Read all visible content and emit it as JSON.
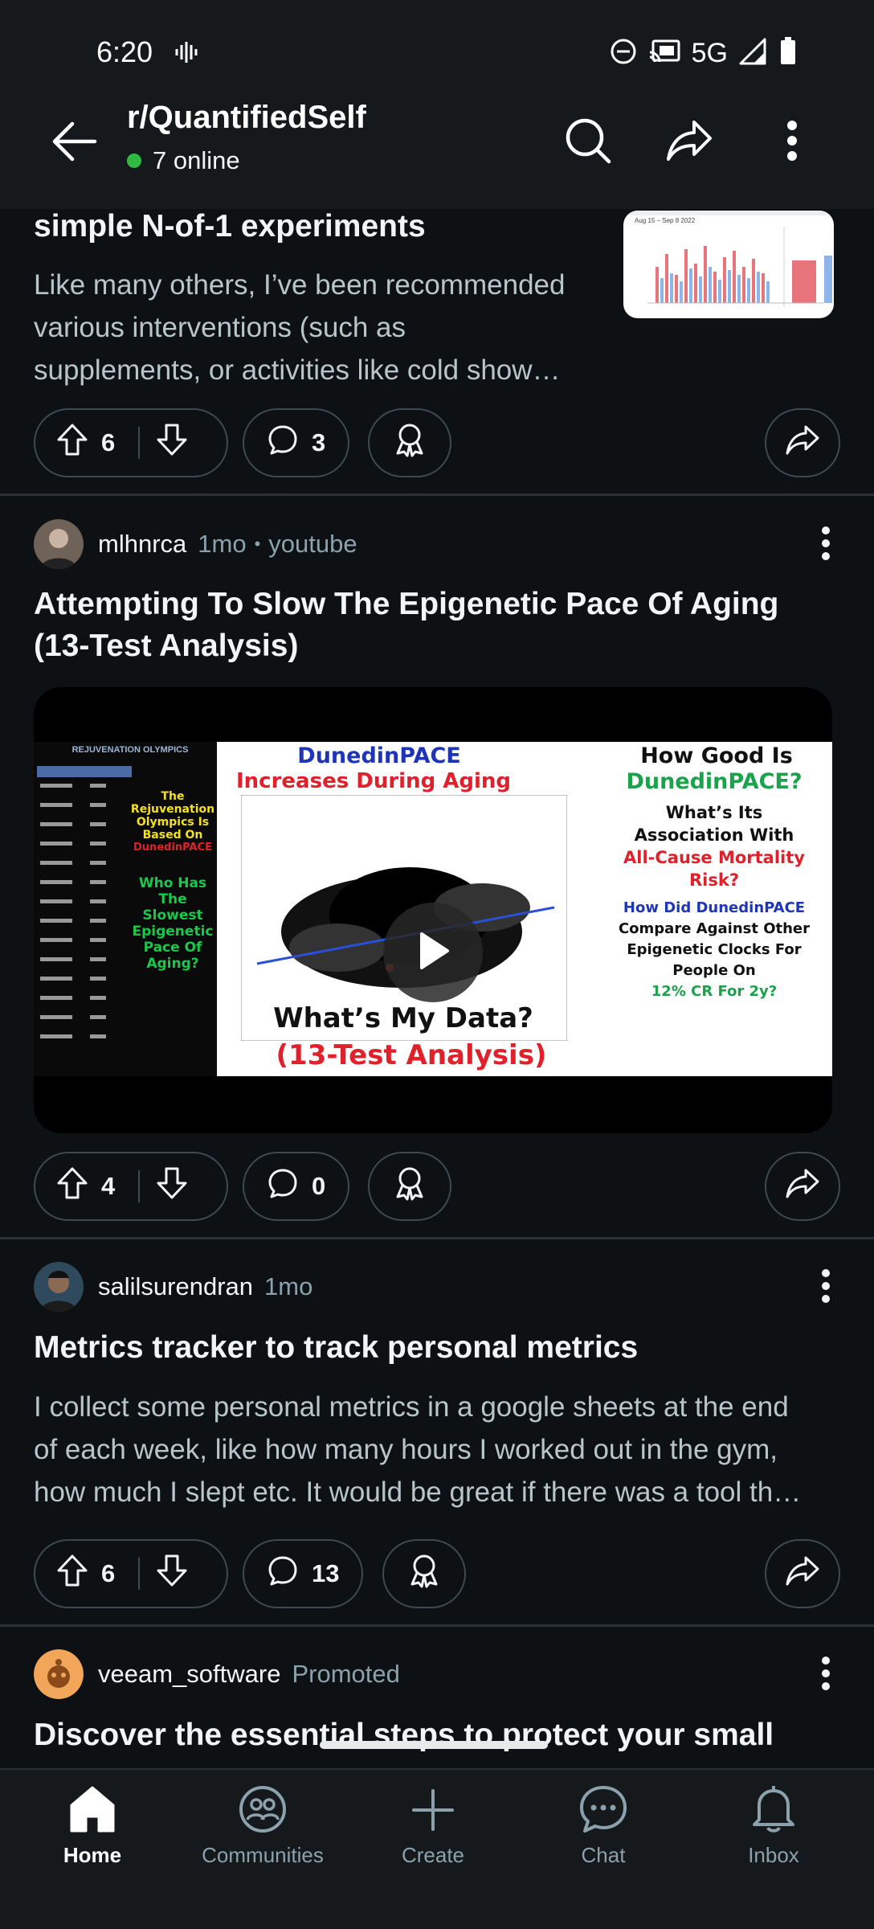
{
  "status": {
    "time": "6:20",
    "network": "5G"
  },
  "header": {
    "subreddit": "r/QuantifiedSelf",
    "online": "7 online"
  },
  "posts": [
    {
      "title": "simple N-of-1 experiments",
      "body_lines": [
        "Like many others, I’ve been recommended",
        "various interventions (such as",
        "supplements, or activities like cold show…"
      ],
      "upvotes": "6",
      "comments": "3",
      "thumbnail_caption": "Aug 15 – Sep 8 2022"
    },
    {
      "author": "mlhnrca",
      "age": "1mo",
      "source": "youtube",
      "title_lines": [
        "Attempting To Slow The Epigenetic Pace Of Aging",
        "(13-Test Analysis)"
      ],
      "upvotes": "4",
      "comments": "0",
      "video": {
        "title_1": "DunedinPACE",
        "title_2": "Increases During Aging",
        "right_1": "How Good Is",
        "right_2": "DunedinPACE?",
        "right_3": "What’s Its",
        "right_4": "Association With",
        "right_5": "All-Cause Mortality",
        "right_6": "Risk?",
        "right_7": "How Did DunedinPACE",
        "right_8": "Compare Against Other",
        "right_9": "Epigenetic Clocks For",
        "right_10": "People On",
        "right_11": "12% CR For 2y?",
        "bottom_1": "What’s My Data?",
        "bottom_2": "(13-Test Analysis)",
        "left_logo": "REJUVENATION OLYMPICS",
        "left_1": "The Rejuvenation Olympics Is Based On",
        "left_2": "DunedinPACE",
        "left_3": "Who Has The Slowest Epigenetic Pace Of Aging?"
      }
    },
    {
      "author": "salilsurendran",
      "age": "1mo",
      "title": "Metrics tracker to track personal metrics",
      "body_lines": [
        "I collect some personal metrics in a google sheets at the end",
        "of each week, like how many hours I worked out in the gym,",
        "how much I slept etc. It would be great if there was a tool th…"
      ],
      "upvotes": "6",
      "comments": "13"
    },
    {
      "author": "veeam_software",
      "tag": "Promoted",
      "title": "Discover the essential steps to protect your small"
    }
  ],
  "nav": {
    "home": "Home",
    "communities": "Communities",
    "create": "Create",
    "chat": "Chat",
    "inbox": "Inbox"
  }
}
